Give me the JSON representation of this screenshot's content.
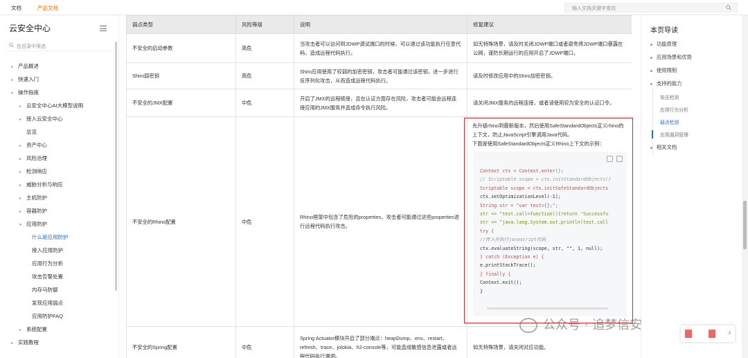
{
  "topbar": {
    "tabs": [
      "文档",
      "产品文档"
    ],
    "search_placeholder": "输入文档关键字查找"
  },
  "sidebar": {
    "title": "云安全中心",
    "filter_placeholder": "在目录中筛选",
    "items": [
      {
        "label": "产品概述",
        "arrow": "▸"
      },
      {
        "label": "快速入门",
        "arrow": "▸"
      },
      {
        "label": "操作指南",
        "arrow": "▾"
      },
      {
        "label": "云安全中心AI大模型说明",
        "arrow": "▸"
      },
      {
        "label": "接入云安全中心",
        "arrow": "▸"
      },
      {
        "label": "总览",
        "arrow": ""
      },
      {
        "label": "资产中心",
        "arrow": "▸"
      },
      {
        "label": "风险治理",
        "arrow": "▸"
      },
      {
        "label": "检测响应",
        "arrow": "▸"
      },
      {
        "label": "威胁分析与响应",
        "arrow": "▸"
      },
      {
        "label": "主机防护",
        "arrow": "▸"
      },
      {
        "label": "容器防护",
        "arrow": "▸"
      },
      {
        "label": "应用防护",
        "arrow": "▾"
      },
      {
        "label": "什么是应用防护",
        "arrow": ""
      },
      {
        "label": "接入应用防护",
        "arrow": ""
      },
      {
        "label": "应用行为分析",
        "arrow": ""
      },
      {
        "label": "攻击告警处置",
        "arrow": ""
      },
      {
        "label": "内存马防御",
        "arrow": ""
      },
      {
        "label": "发现应用弱点",
        "arrow": ""
      },
      {
        "label": "应用防护FAQ",
        "arrow": ""
      },
      {
        "label": "系统配置",
        "arrow": "▸"
      },
      {
        "label": "实践教程",
        "arrow": "▸"
      }
    ]
  },
  "table": {
    "headers": [
      "弱点类型",
      "风险等级",
      "说明",
      "修复建议"
    ],
    "rows": [
      {
        "type": "不安全的启动参数",
        "level": "高危",
        "desc": "当攻击者可以访问到JDWP调试端口的时候，可以通过该功能执行任意代码，造成远程代码执行。",
        "fix": "如无特殊场景，请及时关闭JDWP端口或者避免将JDWP端口暴露在公网，谨防长期运行的应用开启了JDWP端口。"
      },
      {
        "type": "Shiro弱密钥",
        "level": "高危",
        "desc": "Shiro应用使用了较弱的加密密钥，攻击者可能通过该密钥，进一步进行反序列化攻击，从而造成远程代码执行。",
        "fix": "请及时修改应用中的Shiro加密密钥。"
      },
      {
        "type": "不安全的JMX配置",
        "level": "中危",
        "desc": "开启了JMX的远程链接，且在认证方面存在风险，攻击者可能会远程连接应用的JMX服务并造成命令执行风险。",
        "fix": "请关闭JMX服务的远程连接，或者请使用较为安全的认证口令。"
      },
      {
        "type": "不安全的Rhino配置",
        "level": "中危",
        "desc": "Rhino框架中包含了危险的properties，攻击者可能通过这些properties进行远程代码执行攻击。",
        "fix": ""
      },
      {
        "type": "不安全的Spring配置",
        "level": "中危",
        "desc": "Spring Actuator模块开启了部分端点：heapDump、env、restart、refresh、trace、jolokia、h2-console等，可能造成敏感信息泄露或者远程代码执行漏洞。",
        "fix": "如无特殊场景，请关闭对应功能。"
      }
    ],
    "rhino_fix_text": "先升级rhino到最新版本，然后使用SafeStandardObjects定义rhino的上下文，防止JavaScript引擎调用Java代码。",
    "rhino_fix_text2": "下面是使用SafeStandardObjects定义Rhino上下文的示例：",
    "code_lines": [
      "Context ctx = Context.enter();",
      "// Scriptable scope = ctx.initStandardObjects()",
      "Scriptable scope = ctx.initSafeStandardObjects",
      "ctx.setOptimizationLevel(-1);",
      "String str = \"var test={};\";",
      "str += \"test.call=function(){return 'Successfu",
      "str += \"java.lang.System.out.println(test.call",
      "try {",
      "//传入并执行javascript代码",
      "ctx.evaluateString(scope, str, \"\", 1, null);",
      "} catch (Exception e) {",
      "e.printStackTrace();",
      "} finally {",
      "Context.exit();",
      "}"
    ]
  },
  "toc": {
    "title": "本页导读",
    "items": [
      {
        "label": "功能原理",
        "sub": false
      },
      {
        "label": "应用场景和优势",
        "sub": false
      },
      {
        "label": "使用限制",
        "sub": false
      },
      {
        "label": "支持的能力",
        "sub": false
      },
      {
        "label": "攻击检测",
        "sub": true
      },
      {
        "label": "应用行为分析",
        "sub": true
      },
      {
        "label": "弱点检测",
        "sub": true,
        "active": true
      },
      {
        "label": "应用漏洞管理",
        "sub": true
      },
      {
        "label": "相关文档",
        "sub": false
      }
    ]
  },
  "watermark": "公众号 · 追梦信安",
  "colors": {
    "accent": "#1a6fd8",
    "brand": "#ff6a00",
    "highlight": "#dd2222"
  }
}
